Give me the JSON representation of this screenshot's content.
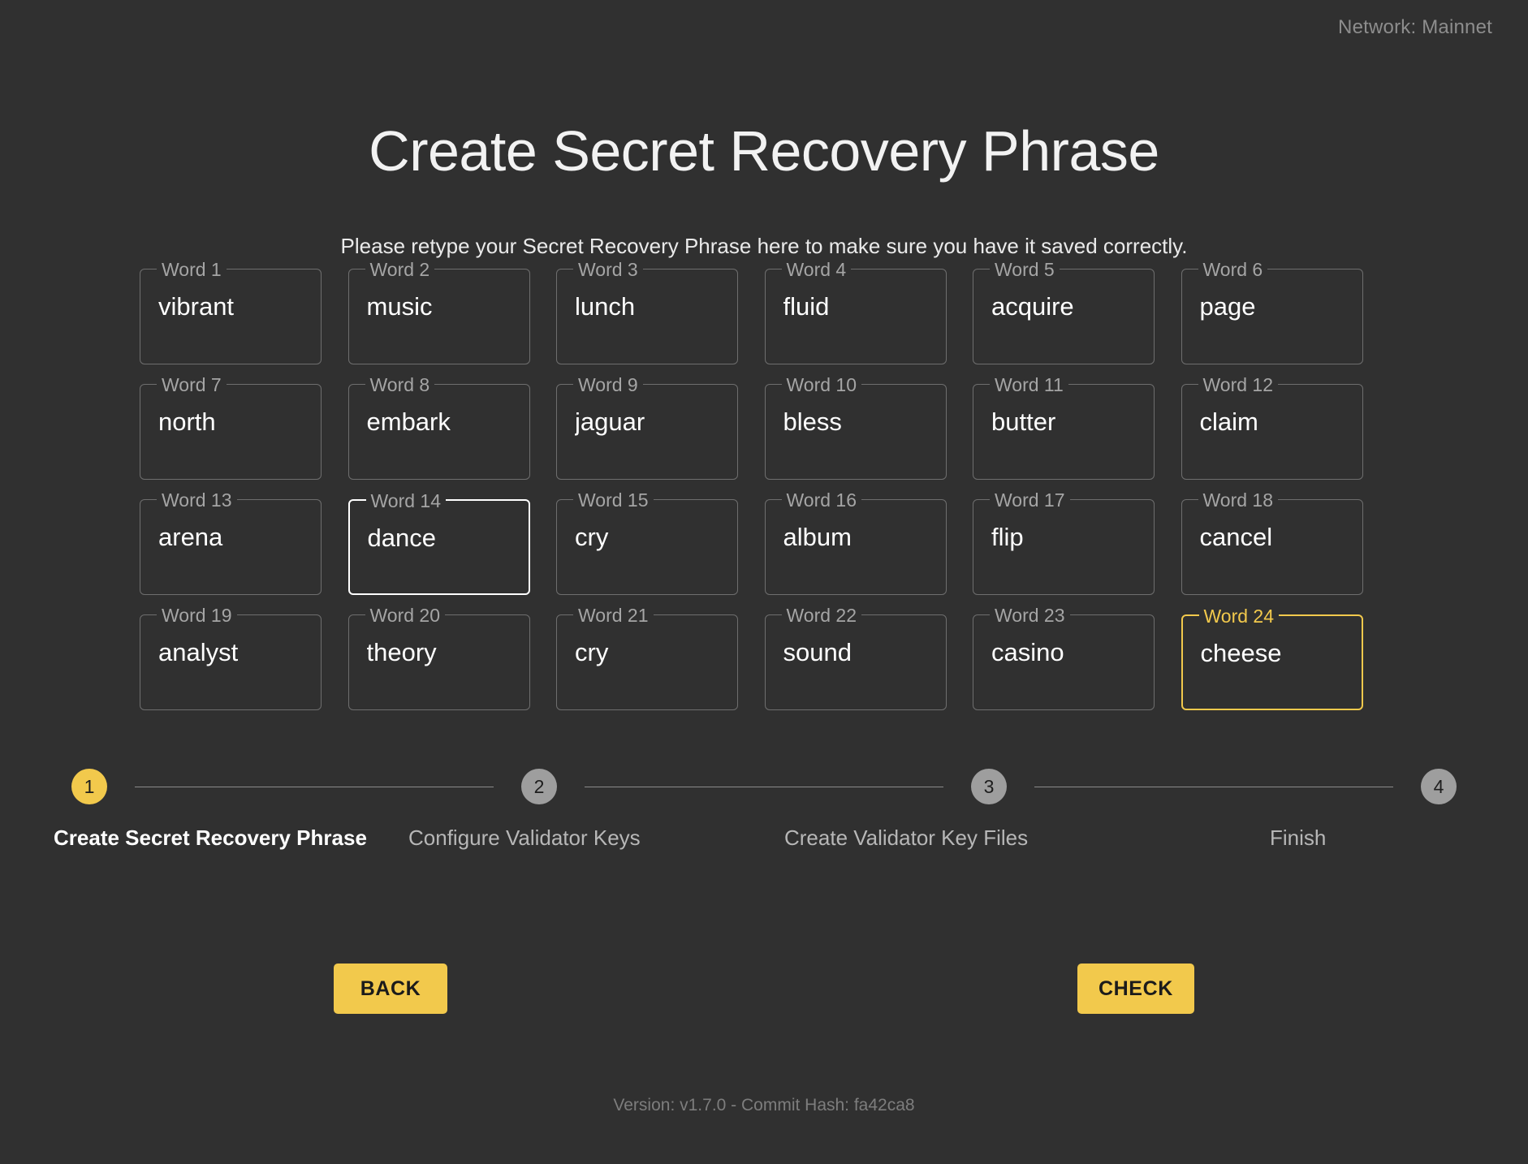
{
  "network": {
    "label": "Network: Mainnet"
  },
  "header": {
    "title": "Create Secret Recovery Phrase",
    "subtitle": "Please retype your Secret Recovery Phrase here to make sure you have it saved correctly."
  },
  "colors": {
    "background": "#303030",
    "accent": "#f2c94c",
    "field_border": "#6e6e6e",
    "field_label": "#a5a5a5",
    "hover_border": "#ffffff",
    "step_inactive": "#9e9e9e"
  },
  "words": [
    {
      "label": "Word 1",
      "value": "vibrant",
      "state": "default"
    },
    {
      "label": "Word 2",
      "value": "music",
      "state": "default"
    },
    {
      "label": "Word 3",
      "value": "lunch",
      "state": "default"
    },
    {
      "label": "Word 4",
      "value": "fluid",
      "state": "default"
    },
    {
      "label": "Word 5",
      "value": "acquire",
      "state": "default"
    },
    {
      "label": "Word 6",
      "value": "page",
      "state": "default"
    },
    {
      "label": "Word 7",
      "value": "north",
      "state": "default"
    },
    {
      "label": "Word 8",
      "value": "embark",
      "state": "default"
    },
    {
      "label": "Word 9",
      "value": "jaguar",
      "state": "default"
    },
    {
      "label": "Word 10",
      "value": "bless",
      "state": "default"
    },
    {
      "label": "Word 11",
      "value": "butter",
      "state": "default"
    },
    {
      "label": "Word 12",
      "value": "claim",
      "state": "default"
    },
    {
      "label": "Word 13",
      "value": "arena",
      "state": "default"
    },
    {
      "label": "Word 14",
      "value": "dance",
      "state": "hover"
    },
    {
      "label": "Word 15",
      "value": "cry",
      "state": "default"
    },
    {
      "label": "Word 16",
      "value": "album",
      "state": "default"
    },
    {
      "label": "Word 17",
      "value": "flip",
      "state": "default"
    },
    {
      "label": "Word 18",
      "value": "cancel",
      "state": "default"
    },
    {
      "label": "Word 19",
      "value": "analyst",
      "state": "default"
    },
    {
      "label": "Word 20",
      "value": "theory",
      "state": "default"
    },
    {
      "label": "Word 21",
      "value": "cry",
      "state": "default"
    },
    {
      "label": "Word 22",
      "value": "sound",
      "state": "default"
    },
    {
      "label": "Word 23",
      "value": "casino",
      "state": "default"
    },
    {
      "label": "Word 24",
      "value": "cheese",
      "state": "focused"
    }
  ],
  "stepper": {
    "active_index": 0,
    "steps": [
      {
        "number": "1",
        "label": "Create Secret Recovery Phrase"
      },
      {
        "number": "2",
        "label": "Configure Validator Keys"
      },
      {
        "number": "3",
        "label": "Create Validator Key Files"
      },
      {
        "number": "4",
        "label": "Finish"
      }
    ]
  },
  "actions": {
    "back_label": "BACK",
    "check_label": "CHECK"
  },
  "footer": {
    "version_text": "Version: v1.7.0 - Commit Hash: fa42ca8"
  }
}
